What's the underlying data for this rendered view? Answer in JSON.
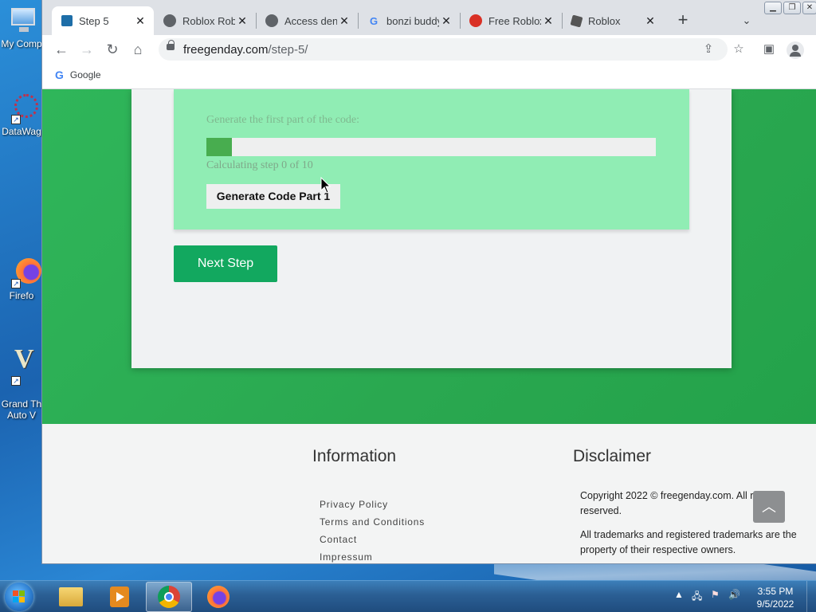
{
  "desktop": {
    "icons": [
      {
        "name": "desktop-icon-my-computer",
        "label": "My Comp"
      },
      {
        "name": "desktop-icon-datawag",
        "label": "DataWag"
      },
      {
        "name": "desktop-icon-firefox",
        "label": "Firefo"
      },
      {
        "name": "desktop-icon-gta",
        "label": "Grand Th\nAuto V"
      }
    ]
  },
  "browser": {
    "tabs": [
      {
        "title": "Step 5",
        "active": true,
        "favicon": "freegenday-icon"
      },
      {
        "title": "Roblox Robux",
        "active": false,
        "favicon": "globe-icon"
      },
      {
        "title": "Access denied",
        "active": false,
        "favicon": "globe-icon"
      },
      {
        "title": "bonzi buddy",
        "active": false,
        "favicon": "google-icon"
      },
      {
        "title": "Free Roblox",
        "active": false,
        "favicon": "red-badge-icon"
      },
      {
        "title": "Roblox",
        "active": false,
        "favicon": "roblox-icon"
      }
    ],
    "new_tab": "+",
    "url": {
      "host": "freegenday.com",
      "path": "/step-5/"
    },
    "bookmark": "Google"
  },
  "page": {
    "generate_label": "Generate the first part of the code:",
    "progress_fraction": 0.057,
    "progress_status": "Calculating step 0 of 10",
    "generate_button": "Generate Code Part 1",
    "next_button": "Next Step",
    "footer": {
      "info_heading": "Information",
      "disclaimer_heading": "Disclaimer",
      "links": [
        "Privacy Policy",
        "Terms and Conditions",
        "Contact",
        "Impressum"
      ],
      "copyright": "Copyright 2022 © freegenday.com. All rights reserved.",
      "trademarks": "All trademarks and registered trademarks are the property of their respective owners."
    }
  },
  "taskbar": {
    "apps": [
      "explorer-icon",
      "media-player-icon",
      "chrome-icon",
      "firefox-icon"
    ],
    "time": "3:55 PM",
    "date": "9/5/2022"
  },
  "colors": {
    "hero_green": "#2fb65a",
    "gen_box": "#90edb4",
    "progress_fill": "#48ad4f",
    "next_button": "#12a85f"
  }
}
